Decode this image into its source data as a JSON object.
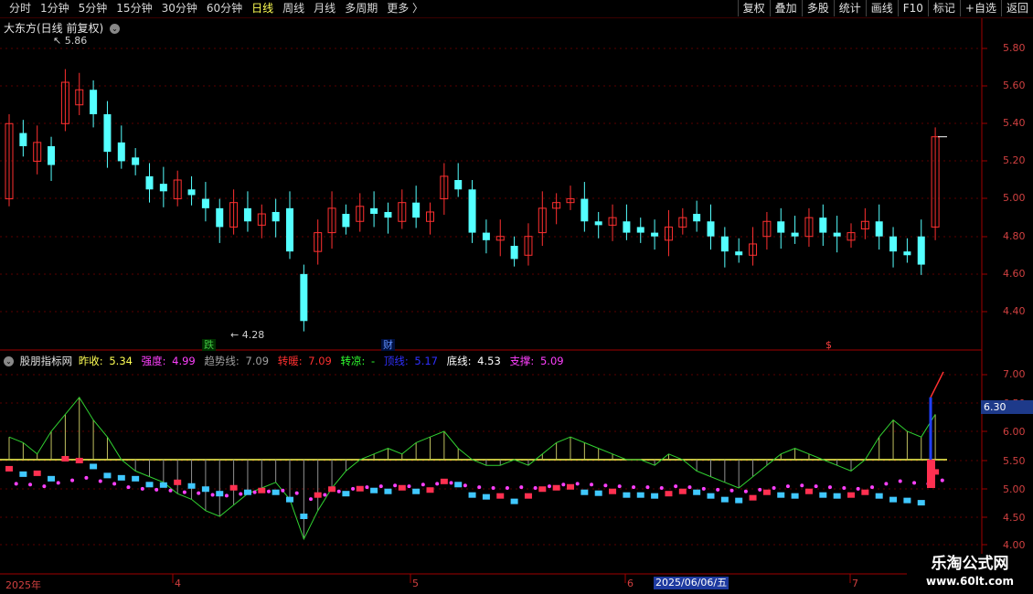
{
  "toolbar": {
    "periods": [
      "分时",
      "1分钟",
      "5分钟",
      "15分钟",
      "30分钟",
      "60分钟",
      "日线",
      "周线",
      "月线",
      "多周期",
      "更多 〉"
    ],
    "active_period": "日线",
    "buttons": [
      "复权",
      "叠加",
      "多股",
      "统计",
      "画线",
      "F10",
      "标记",
      "+自选",
      "返回"
    ]
  },
  "main_chart": {
    "title": "大东方(日线 前复权)",
    "high_marker": "5.86",
    "low_marker": "4.28",
    "price_ticks": [
      "5.80",
      "5.60",
      "5.40",
      "5.20",
      "5.00",
      "4.80",
      "4.60",
      "4.40"
    ],
    "event_tags": [
      {
        "text": "跌",
        "color": "#40c040"
      },
      {
        "text": "财",
        "color": "#4080ff"
      },
      {
        "text": "$",
        "color": "#ff4040"
      }
    ]
  },
  "indicator": {
    "name": "股朋指标网",
    "items": [
      {
        "label": "昨收:",
        "value": "5.34",
        "color": "#ffff54"
      },
      {
        "label": "强度:",
        "value": "4.99",
        "color": "#ff40ff"
      },
      {
        "label": "趋势线:",
        "value": "7.09",
        "color": "#a0a0a0"
      },
      {
        "label": "转暖:",
        "value": "7.09",
        "color": "#ff3030"
      },
      {
        "label": "转凉:",
        "value": "-",
        "color": "#30ff30"
      },
      {
        "label": "顶线:",
        "value": "5.17",
        "color": "#3030ff"
      },
      {
        "label": "底线:",
        "value": "4.53",
        "color": "#ffffff"
      },
      {
        "label": "支撑:",
        "value": "5.09",
        "color": "#ff40ff"
      }
    ],
    "ticks": [
      "7.00",
      "6.50",
      "6.00",
      "5.50",
      "5.00",
      "4.50",
      "4.00"
    ],
    "current_value": "6.30"
  },
  "time_axis": {
    "labels": [
      "2025年",
      "4",
      "5",
      "6",
      "7"
    ],
    "highlight": "2025/06/06/五"
  },
  "watermark": {
    "line1": "乐淘公式网",
    "line2": "www.60lt.com"
  },
  "colors": {
    "up": "#ff3030",
    "down": "#54ffff",
    "grid": "#700000",
    "axis_text": "#d04040"
  }
}
